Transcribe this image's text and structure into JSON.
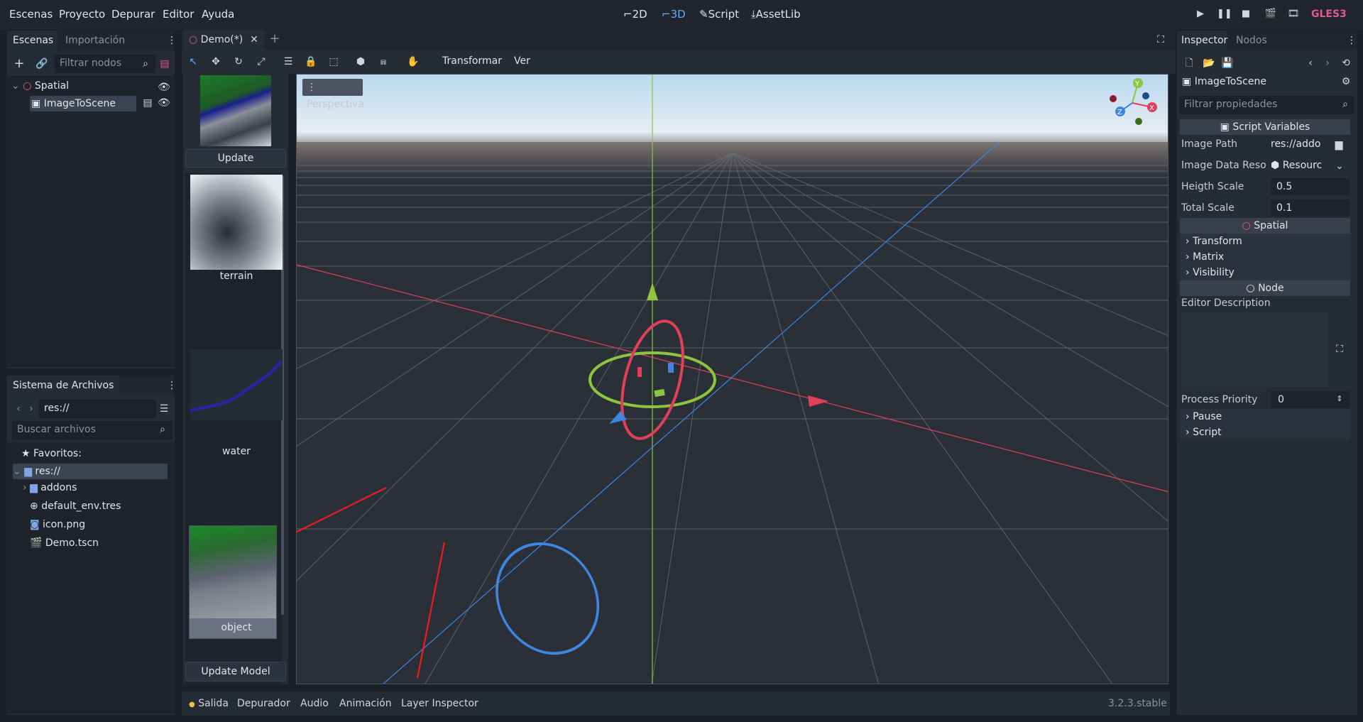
{
  "menu": {
    "items": [
      "Escenas",
      "Proyecto",
      "Depurar",
      "Editor",
      "Ayuda"
    ],
    "workspaces": [
      {
        "icon": "2d-icon",
        "label": "2D"
      },
      {
        "icon": "3d-icon",
        "label": "3D"
      },
      {
        "icon": "script-icon",
        "label": "Script"
      },
      {
        "icon": "assetlib-icon",
        "label": "AssetLib"
      }
    ],
    "renderer": "GLES3"
  },
  "scene_dock": {
    "tabs": [
      "Escenas",
      "Importación"
    ],
    "filter_placeholder": "Filtrar nodos",
    "nodes": [
      {
        "name": "Spatial"
      },
      {
        "name": "ImageToScene"
      }
    ]
  },
  "filesystem_dock": {
    "title": "Sistema de Archivos",
    "path": "res://",
    "search_placeholder": "Buscar archivos",
    "items": [
      {
        "label": "Favoritos:"
      },
      {
        "label": "res://"
      },
      {
        "label": "addons"
      },
      {
        "label": "default_env.tres"
      },
      {
        "label": "icon.png"
      },
      {
        "label": "Demo.tscn"
      }
    ]
  },
  "editor_tabs": {
    "scene_tab": "Demo(*)"
  },
  "toolbar": {
    "transform_menu": "Transformar",
    "view_menu": "Ver"
  },
  "layer_panel": {
    "update_button": "Update",
    "layers": [
      {
        "label": "terrain"
      },
      {
        "label": "water"
      },
      {
        "label": "object"
      }
    ],
    "update_model_button": "Update Model"
  },
  "viewport": {
    "perspective_label": "Perspectiva",
    "gizmo_axes": [
      "Y",
      "X",
      "Z"
    ]
  },
  "inspector": {
    "tabs": [
      "Inspector",
      "Nodos"
    ],
    "object_name": "ImageToScene",
    "filter_placeholder": "Filtrar propiedades",
    "sections": {
      "script_variables": "Script Variables",
      "spatial": "Spatial",
      "node": "Node"
    },
    "properties": [
      {
        "label": "Image Path",
        "value": "res://addo"
      },
      {
        "label": "Image Data Reso",
        "value": "Resourc"
      },
      {
        "label": "Heigth Scale",
        "value": "0.5"
      },
      {
        "label": "Total Scale",
        "value": "0.1"
      }
    ],
    "spatial_groups": [
      "Transform",
      "Matrix",
      "Visibility"
    ],
    "editor_description_label": "Editor Description",
    "process_priority_label": "Process Priority",
    "process_priority_value": "0",
    "node_groups": [
      "Pause",
      "Script"
    ]
  },
  "bottom_panel": {
    "tabs": [
      "Salida",
      "Depurador",
      "Audio",
      "Animación",
      "Layer Inspector"
    ],
    "version": "3.2.3.stable"
  },
  "colors": {
    "accent": "#66a8ff",
    "gles3": "#e05c86",
    "axis_x": "#e0405a",
    "axis_y": "#8cc63e",
    "axis_z": "#3e86e0"
  }
}
